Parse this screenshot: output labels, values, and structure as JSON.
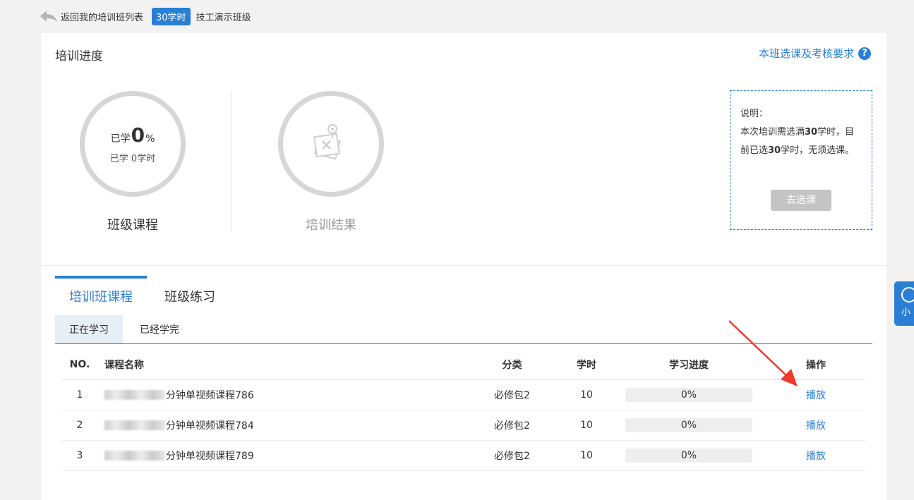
{
  "header": {
    "back_label": "返回我的培训班列表",
    "hours_badge": "30学时",
    "class_name": "技工演示班级"
  },
  "progress_section": {
    "title": "培训进度",
    "requirements_link": "本班选课及考核要求",
    "help_glyph": "?",
    "course_ring": {
      "prefix": "已学",
      "percent": "0",
      "percent_sign": "%",
      "hours_text": "已学 0学时",
      "label": "班级课程"
    },
    "result_ring": {
      "label": "培训结果"
    },
    "note": {
      "title": "说明：",
      "line_prefix": "本次培训需选满",
      "required_hours": "30",
      "line_mid": "学时，目前已选",
      "selected_hours": "30",
      "line_suffix": "学时，无须选课。",
      "button_label": "去选课"
    }
  },
  "tabs": [
    {
      "label": "培训班课程",
      "active": true
    },
    {
      "label": "班级练习",
      "active": false
    }
  ],
  "subtabs": [
    {
      "label": "正在学习",
      "active": true
    },
    {
      "label": "已经学完",
      "active": false
    }
  ],
  "table": {
    "headers": {
      "no": "NO.",
      "name": "课程名称",
      "category": "分类",
      "hours": "学时",
      "progress": "学习进度",
      "action": "操作"
    },
    "rows": [
      {
        "no": "1",
        "name_suffix": "分钟单视频课程786",
        "category": "必修包2",
        "hours": "10",
        "progress_pct": 0,
        "progress_text": "0%",
        "action": "播放"
      },
      {
        "no": "2",
        "name_suffix": "分钟单视频课程784",
        "category": "必修包2",
        "hours": "10",
        "progress_pct": 0,
        "progress_text": "0%",
        "action": "播放"
      },
      {
        "no": "3",
        "name_suffix": "分钟单视频课程789",
        "category": "必修包2",
        "hours": "10",
        "progress_pct": 0,
        "progress_text": "0%",
        "action": "播放"
      }
    ]
  },
  "float_widget": {
    "label": "小"
  },
  "colors": {
    "accent": "#2a7fd4",
    "annotation_arrow": "#f03a2e"
  }
}
